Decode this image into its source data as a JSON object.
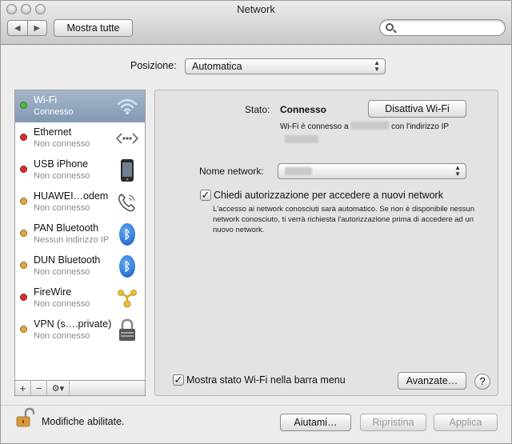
{
  "window": {
    "title": "Network"
  },
  "toolbar": {
    "show_all_label": "Mostra tutte",
    "search_placeholder": ""
  },
  "location": {
    "label": "Posizione:",
    "value": "Automatica"
  },
  "services": [
    {
      "name": "Wi-Fi",
      "status": "Connesso",
      "dot_color": "#4bbd3a",
      "icon": "wifi-icon",
      "selected": true
    },
    {
      "name": "Ethernet",
      "status": "Non connesso",
      "dot_color": "#d4302b",
      "icon": "ethernet-icon"
    },
    {
      "name": "USB iPhone",
      "status": "Non connesso",
      "dot_color": "#d4302b",
      "icon": "iphone-icon"
    },
    {
      "name": "HUAWEI…odem",
      "status": "Non connesso",
      "dot_color": "#e9a23b",
      "icon": "modem-phone-icon"
    },
    {
      "name": "PAN Bluetooth",
      "status": "Nessun indirizzo IP",
      "dot_color": "#e9a23b",
      "icon": "bluetooth-icon"
    },
    {
      "name": "DUN Bluetooth",
      "status": "Non connesso",
      "dot_color": "#e9a23b",
      "icon": "bluetooth-icon"
    },
    {
      "name": "FireWire",
      "status": "Non connesso",
      "dot_color": "#d4302b",
      "icon": "firewire-icon"
    },
    {
      "name": "VPN (s….private)",
      "status": "Non connesso",
      "dot_color": "#e9a23b",
      "icon": "vpn-lock-icon"
    }
  ],
  "sidebar_tools": {
    "add": "+",
    "remove": "−",
    "gear": "⚙▾"
  },
  "detail": {
    "status_label": "Stato:",
    "status_value": "Connesso",
    "disable_button": "Disattiva Wi-Fi",
    "connected_prefix": "Wi-Fi è connesso a",
    "connected_suffix": "con l'indirizzo IP",
    "network_name_label": "Nome network:",
    "ask_label": "Chiedi autorizzazione per accedere a nuovi network",
    "ask_checked": true,
    "note": "L'accesso ai network conosciuti sarà automatico. Se non è disponibile nessun network conosciuto, ti verrà richiesta l'autorizzazione prima di accedere ad un nuovo network.",
    "show_menu_label": "Mostra stato Wi-Fi nella barra menu",
    "show_menu_checked": true,
    "advanced_button": "Avanzate…",
    "help": "?"
  },
  "footer": {
    "lock_label": "Modifiche abilitate.",
    "assist_button": "Aiutami…",
    "revert_button": "Ripristina",
    "apply_button": "Applica"
  },
  "colors": {
    "selection": "#8ea2bd",
    "connected": "#4bbd3a",
    "disconnected": "#d4302b",
    "inactive": "#e9a23b"
  }
}
